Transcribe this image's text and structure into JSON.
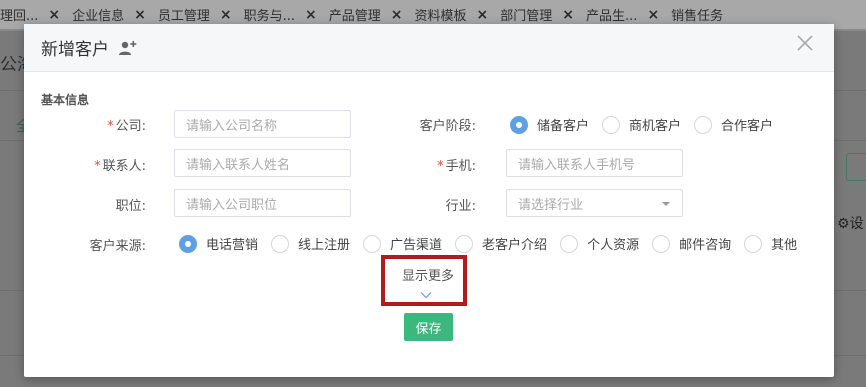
{
  "tabs": [
    {
      "label": "理回..."
    },
    {
      "label": "企业信息"
    },
    {
      "label": "员工管理"
    },
    {
      "label": "职务与..."
    },
    {
      "label": "产品管理"
    },
    {
      "label": "资料模板"
    },
    {
      "label": "部门管理"
    },
    {
      "label": "产品生..."
    },
    {
      "label": "销售任务"
    }
  ],
  "tab_close": "×",
  "background": {
    "left_title": "公海",
    "left_tab": "全",
    "right_label": "设"
  },
  "modal": {
    "title": "新增客户",
    "title_icon": "add-user-icon",
    "close_icon": "close-icon",
    "section": "基本信息",
    "fields": {
      "company": {
        "label": "公司:",
        "required": true,
        "placeholder": "请输入公司名称"
      },
      "contact": {
        "label": "联系人:",
        "required": true,
        "placeholder": "请输入联系人姓名"
      },
      "position": {
        "label": "职位:",
        "required": false,
        "placeholder": "请输入公司职位"
      },
      "phone": {
        "label": "手机:",
        "required": true,
        "placeholder": "请输入联系人手机号"
      },
      "industry": {
        "label": "行业:",
        "required": false,
        "placeholder": "请选择行业"
      },
      "stage": {
        "label": "客户阶段:",
        "options": [
          "储备客户",
          "商机客户",
          "合作客户"
        ],
        "selected": "储备客户"
      },
      "source": {
        "label": "客户来源:",
        "options": [
          "电话营销",
          "线上注册",
          "广告渠道",
          "老客户介绍",
          "个人资源",
          "邮件咨询",
          "其他"
        ],
        "selected": "电话营销"
      }
    },
    "required_mark": "*",
    "show_more": "显示更多",
    "save": "保存"
  },
  "colors": {
    "accent_radio": "#5fa0e3",
    "save_button": "#3bb87d",
    "highlight_box": "#b01c1c",
    "required": "#e74c3c"
  }
}
